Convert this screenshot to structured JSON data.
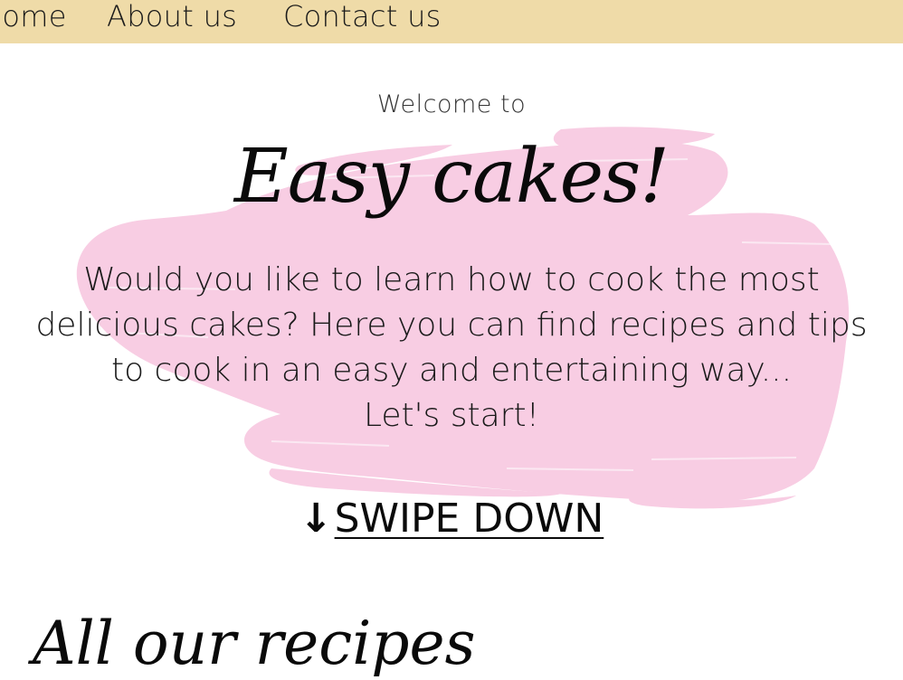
{
  "nav": {
    "items": [
      {
        "label": "Home"
      },
      {
        "label": "About us"
      },
      {
        "label": "Contact us"
      }
    ],
    "background": "#efdba8"
  },
  "hero": {
    "welcome": "Welcome to",
    "brand": "Easy cakes!",
    "lead_lines": [
      "Would you like to learn how to cook the most",
      "delicious cakes? Here you can find recipes and tips",
      "to cook in an easy and entertaining way...",
      "Let's start!"
    ],
    "brush_color": "#f8cde3",
    "swipe_arrow": "↓",
    "swipe_label": "SWIPE DOWN"
  },
  "recipes": {
    "heading": "All our recipes"
  }
}
